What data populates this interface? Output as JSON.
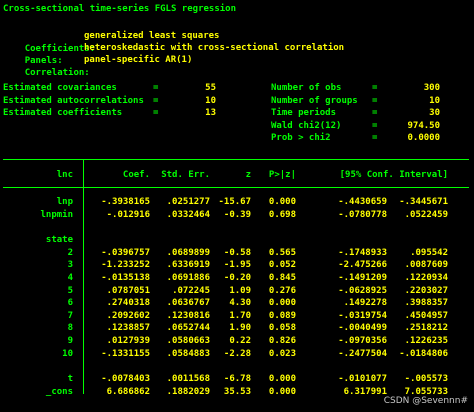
{
  "title": "Cross-sectional time-series FGLS regression",
  "info": [
    {
      "label": "Coefficients",
      "value": "generalized least squares"
    },
    {
      "label": "Panels",
      "value": "heteroskedastic with cross-sectional correlation"
    },
    {
      "label": "Correlation",
      "value": "panel-specific AR(1)"
    }
  ],
  "stats_left": [
    {
      "label": "Estimated covariances",
      "eq": "=",
      "value": "55"
    },
    {
      "label": "Estimated autocorrelations",
      "eq": "=",
      "value": "10"
    },
    {
      "label": "Estimated coefficients",
      "eq": "=",
      "value": "13"
    }
  ],
  "stats_right": [
    {
      "label": "Number of obs",
      "eq": "=",
      "value": "300"
    },
    {
      "label": "Number of groups",
      "eq": "=",
      "value": "10"
    },
    {
      "label": "Time periods",
      "eq": "=",
      "value": "30"
    },
    {
      "label": "Wald chi2(12)",
      "eq": "=",
      "value": "974.50"
    },
    {
      "label": "Prob > chi2",
      "eq": "=",
      "value": "0.0000"
    }
  ],
  "table": {
    "depvar": "lnc",
    "headers": [
      "Coef.",
      "Std. Err.",
      "z",
      "P>|z|",
      "[95% Conf. Interval]"
    ],
    "rows_top": [
      {
        "name": "lnp",
        "coef": "-.3938165",
        "se": ".0251277",
        "z": "-15.67",
        "p": "0.000",
        "lo": "-.4430659",
        "hi": "-.3445671"
      },
      {
        "name": "lnpmin",
        "coef": "-.012916",
        "se": ".0332464",
        "z": "-0.39",
        "p": "0.698",
        "lo": "-.0780778",
        "hi": ".0522459"
      }
    ],
    "group_label": "state",
    "rows_state": [
      {
        "name": "2",
        "coef": "-.0396757",
        "se": ".0689899",
        "z": "-0.58",
        "p": "0.565",
        "lo": "-.1748933",
        "hi": ".095542"
      },
      {
        "name": "3",
        "coef": "-1.233252",
        "se": ".6336919",
        "z": "-1.95",
        "p": "0.052",
        "lo": "-2.475266",
        "hi": ".0087609"
      },
      {
        "name": "4",
        "coef": "-.0135138",
        "se": ".0691886",
        "z": "-0.20",
        "p": "0.845",
        "lo": "-.1491209",
        "hi": ".1220934"
      },
      {
        "name": "5",
        "coef": ".0787051",
        "se": ".072245",
        "z": "1.09",
        "p": "0.276",
        "lo": "-.0628925",
        "hi": ".2203027"
      },
      {
        "name": "6",
        "coef": ".2740318",
        "se": ".0636767",
        "z": "4.30",
        "p": "0.000",
        "lo": ".1492278",
        "hi": ".3988357"
      },
      {
        "name": "7",
        "coef": ".2092602",
        "se": ".1230816",
        "z": "1.70",
        "p": "0.089",
        "lo": "-.0319754",
        "hi": ".4504957"
      },
      {
        "name": "8",
        "coef": ".1238857",
        "se": ".0652744",
        "z": "1.90",
        "p": "0.058",
        "lo": "-.0040499",
        "hi": ".2518212"
      },
      {
        "name": "9",
        "coef": ".0127939",
        "se": ".0580663",
        "z": "0.22",
        "p": "0.826",
        "lo": "-.0970356",
        "hi": ".1226235"
      },
      {
        "name": "10",
        "coef": "-.1331155",
        "se": ".0584883",
        "z": "-2.28",
        "p": "0.023",
        "lo": "-.2477504",
        "hi": "-.0184806"
      }
    ],
    "rows_bottom": [
      {
        "name": "t",
        "coef": "-.0078403",
        "se": ".0011568",
        "z": "-6.78",
        "p": "0.000",
        "lo": "-.0101077",
        "hi": "-.005573"
      },
      {
        "name": "_cons",
        "coef": "6.686862",
        "se": ".1882029",
        "z": "35.53",
        "p": "0.000",
        "lo": "6.317991",
        "hi": "7.055733"
      }
    ]
  },
  "watermark": "CSDN @Sevennn#",
  "colors": {
    "background": "#000000",
    "label": "#00ff00",
    "value": "#ffff00",
    "text": "#ffffff"
  }
}
